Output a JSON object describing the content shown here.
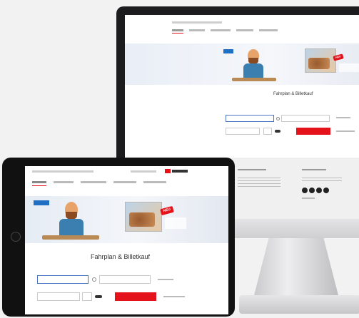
{
  "hero": {
    "title": "Fahrplan & Billetkauf",
    "badge": "NEU"
  },
  "colors": {
    "accent_red": "#e3121b",
    "field_highlight": "#4a73c7"
  }
}
